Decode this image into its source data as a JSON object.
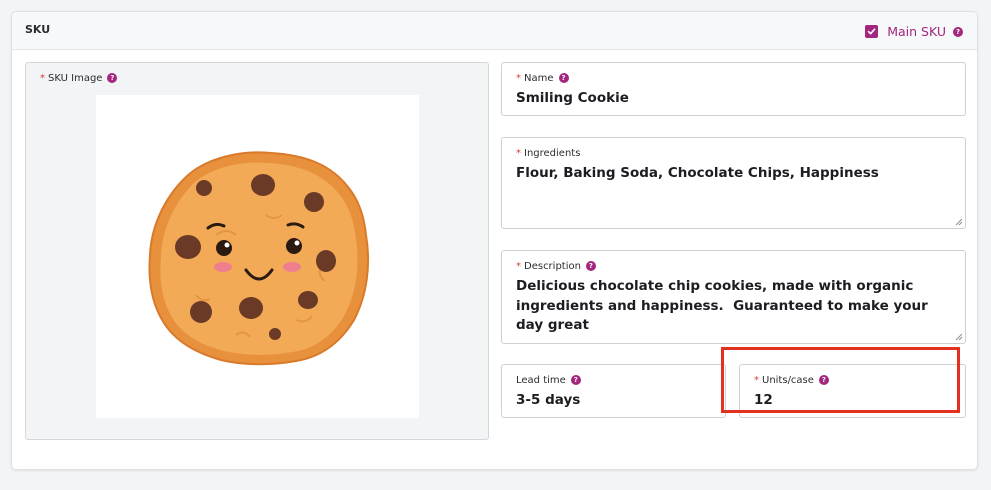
{
  "card": {
    "title": "SKU",
    "main_sku": {
      "label": "Main SKU",
      "checked": true
    }
  },
  "help_glyph": "?",
  "required_mark": "*",
  "image": {
    "label": "SKU Image",
    "alt": "Smiling cookie illustration"
  },
  "fields": {
    "name": {
      "label": "Name",
      "value": "Smiling Cookie"
    },
    "ingredients": {
      "label": "Ingredients",
      "value": "Flour, Baking Soda, Chocolate Chips, Happiness"
    },
    "description": {
      "label": "Description",
      "value": "Delicious chocolate chip cookies, made with organic ingredients and happiness.  Guaranteed to make your day great"
    },
    "lead_time": {
      "label": "Lead time",
      "value": "3-5 days"
    },
    "units_per_case": {
      "label": "Units/case",
      "value": "12"
    }
  },
  "colors": {
    "accent": "#a3267f",
    "required": "#d43f3a",
    "highlight": "#e3301f"
  }
}
